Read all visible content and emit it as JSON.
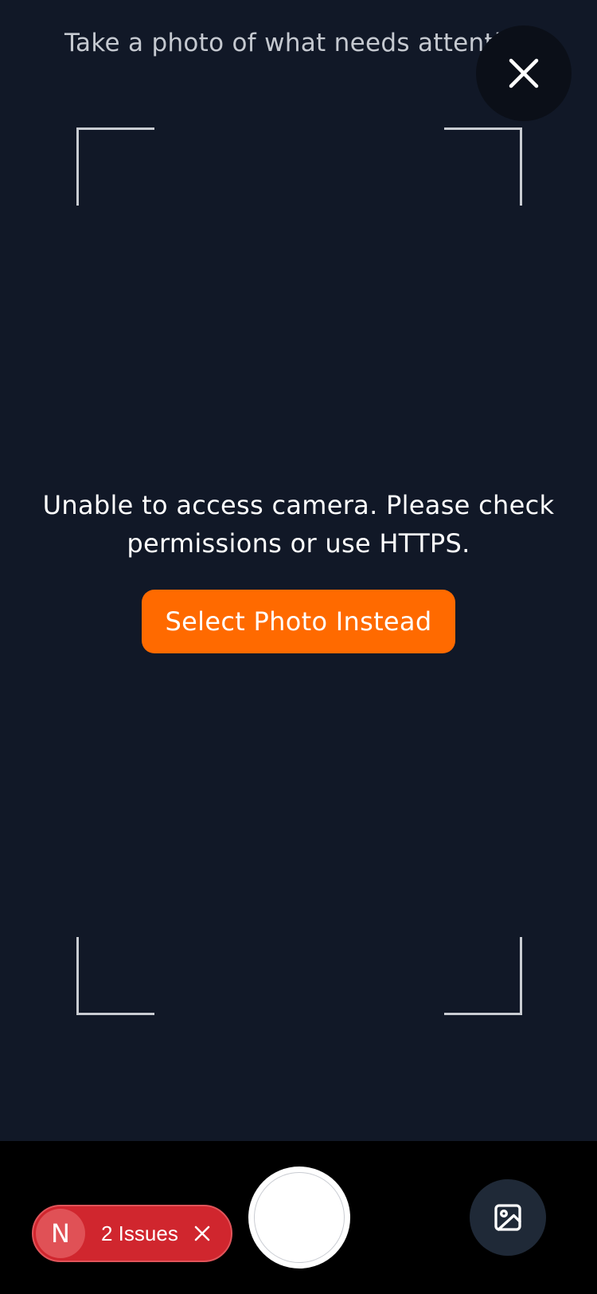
{
  "header": {
    "instruction": "Take a photo of what needs attention",
    "close_icon": "close-icon"
  },
  "viewfinder": {
    "corner_color": "#c9ccd2"
  },
  "error": {
    "message": "Unable to access camera. Please check permissions or use HTTPS.",
    "button_label": "Select Photo Instead",
    "button_color": "#ff6a00"
  },
  "bottom_bar": {
    "shutter_icon": "shutter-button",
    "gallery_icon": "image-icon"
  },
  "issues_badge": {
    "avatar_letter": "N",
    "label": "2 Issues",
    "color": "#d0262e",
    "close_icon": "close-icon"
  },
  "colors": {
    "background": "#111827",
    "bottom_bar": "#000000",
    "accent": "#ff6a00"
  }
}
